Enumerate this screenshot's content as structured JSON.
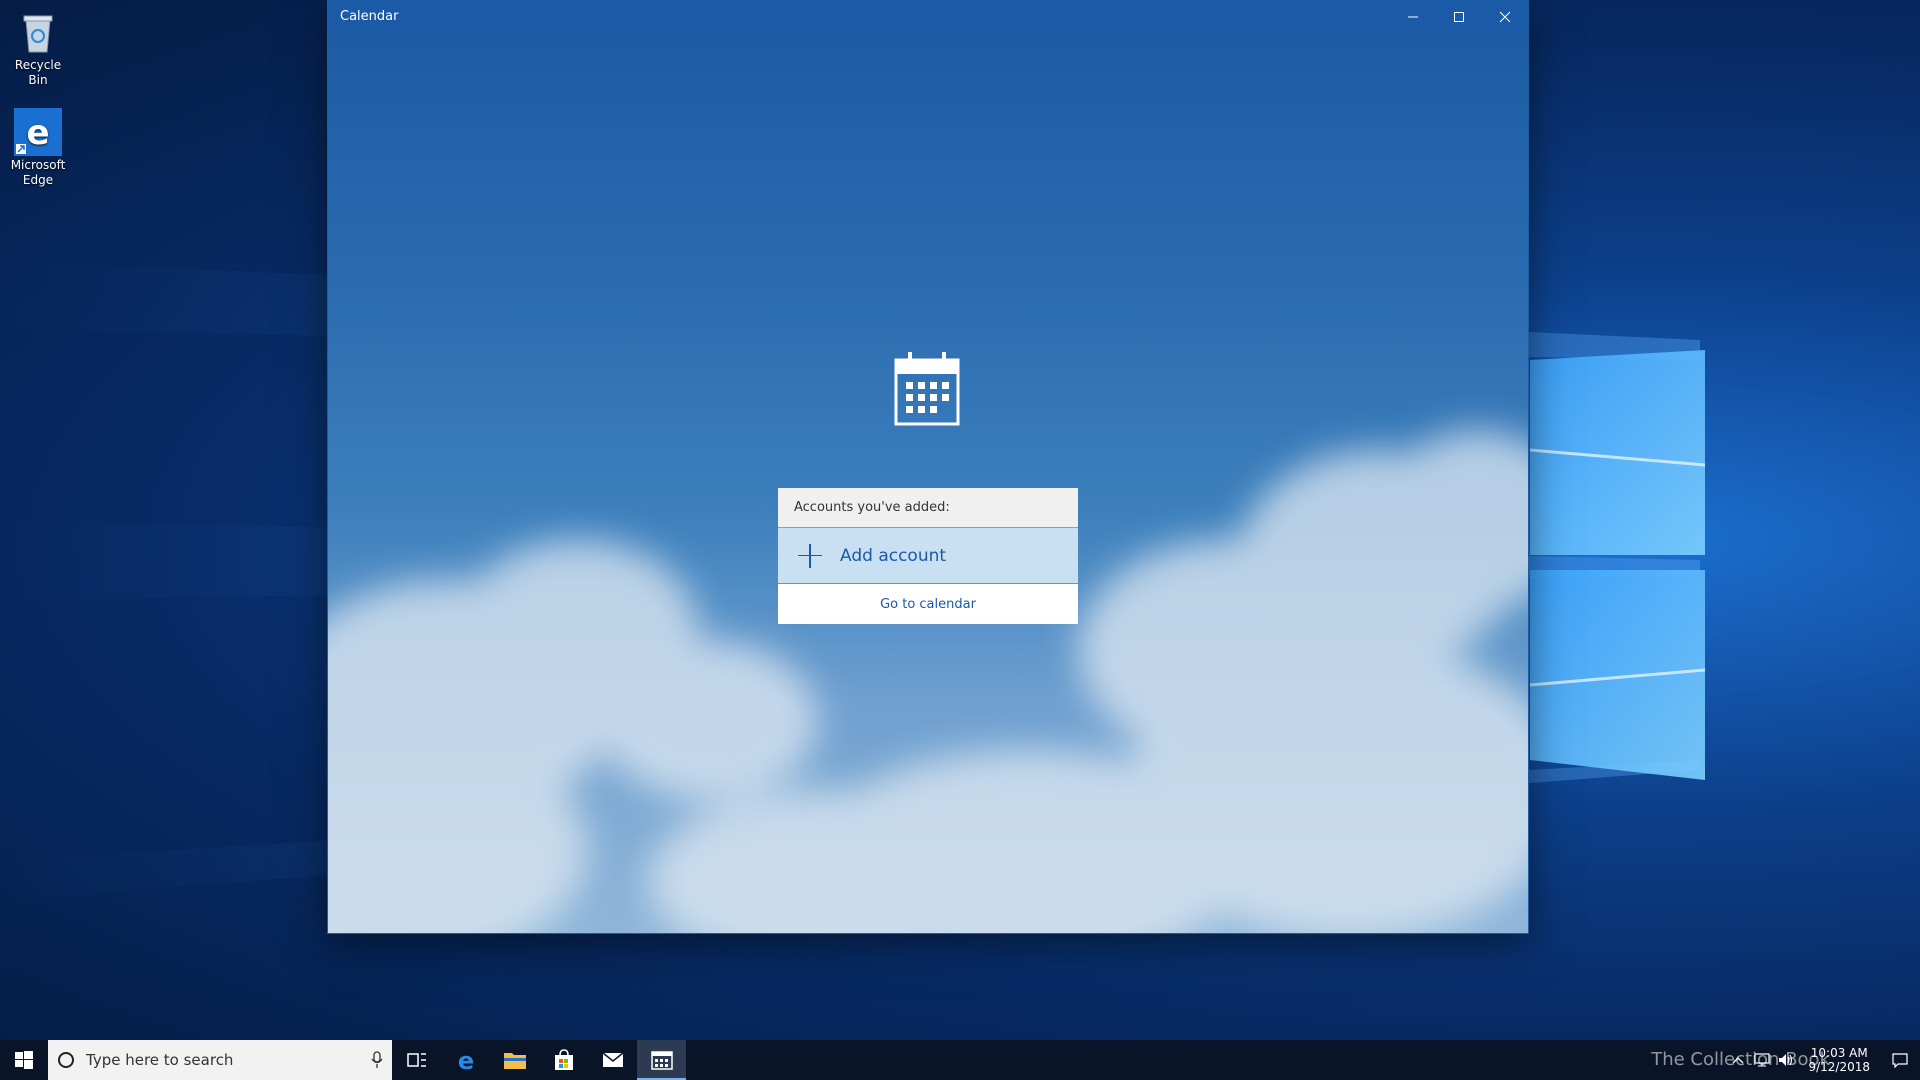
{
  "desktop": {
    "icons": [
      {
        "label": "Recycle Bin",
        "icon": "recycle-bin-icon"
      },
      {
        "label": "Microsoft Edge",
        "icon": "edge-icon"
      }
    ]
  },
  "window": {
    "title": "Calendar",
    "controls": [
      "minimize-icon",
      "maximize-icon",
      "close-icon"
    ]
  },
  "accounts": {
    "header": "Accounts you've added:",
    "add_account": "Add account",
    "go_to_calendar": "Go to calendar"
  },
  "taskbar": {
    "search_placeholder": "Type here to search",
    "items": [
      "task-view-icon",
      "edge-icon",
      "file-explorer-icon",
      "store-icon",
      "mail-icon",
      "calendar-icon"
    ],
    "active_item": "calendar-icon",
    "clock_time": "10:03 AM",
    "clock_date": "9/12/2018"
  },
  "watermark": "The Collection Book",
  "colors": {
    "accent": "#1a5aa6",
    "add_account_bg": "#c9dff2",
    "taskbar_bg": "#0a1428"
  }
}
